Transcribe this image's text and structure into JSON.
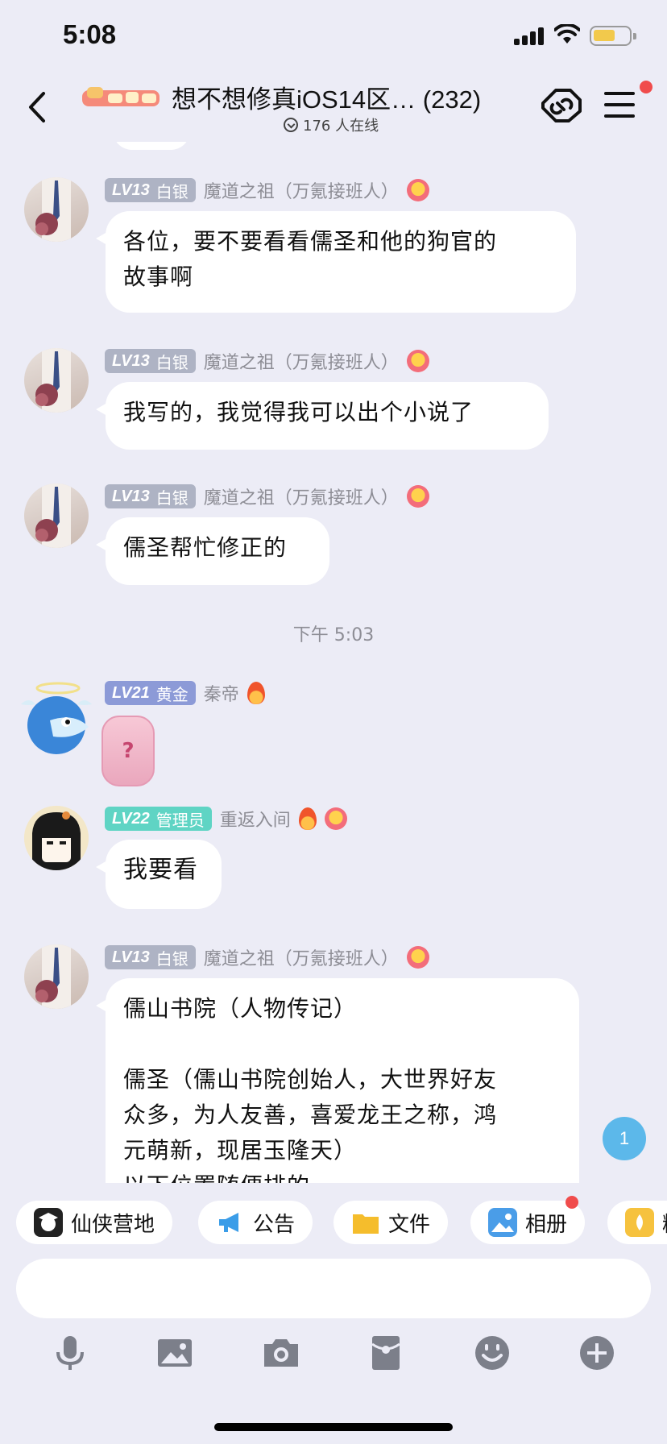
{
  "status_bar": {
    "time": "5:08"
  },
  "header": {
    "title": "想不想修真iOS14区… (232)",
    "online_count": "176 人在线"
  },
  "messages": [
    {
      "level": "LV13",
      "rank": "白银",
      "name": "魔道之祖（万氪接班人）",
      "lines": [
        "各位，要不要看看儒圣和他的狗官的",
        "故事啊"
      ]
    },
    {
      "level": "LV13",
      "rank": "白银",
      "name": "魔道之祖（万氪接班人）",
      "lines": [
        "我写的，我觉得我可以出个小说了"
      ]
    },
    {
      "level": "LV13",
      "rank": "白银",
      "name": "魔道之祖（万氪接班人）",
      "lines": [
        "儒圣帮忙修正的"
      ]
    },
    {
      "level": "LV21",
      "rank": "黄金",
      "name": "秦帝",
      "sticker": "?"
    },
    {
      "level": "LV22",
      "rank": "管理员",
      "name": "重返入间",
      "lines": [
        "我要看"
      ]
    },
    {
      "level": "LV13",
      "rank": "白银",
      "name": "魔道之祖（万氪接班人）",
      "lines": [
        "儒山书院（人物传记）",
        "",
        "儒圣（儒山书院创始人，大世界好友",
        "众多，为人友善，喜爱龙王之称，鸿",
        "元萌新，现居玉隆天）",
        "以下位置随便排的"
      ]
    }
  ],
  "time_divider": "下午 5:03",
  "unread_count": "1",
  "shortcuts": [
    "仙侠营地",
    "公告",
    "文件",
    "相册",
    "精"
  ],
  "colors": {
    "background": "#ececf6",
    "badge_silver": "#aeb3c4",
    "badge_gold": "#8c9ad7",
    "badge_admin": "#5fd4c4",
    "unread_blue": "#5cb8ea",
    "notify_red": "#f04c4c"
  },
  "icons": {
    "toolbar": [
      "microphone-icon",
      "image-icon",
      "camera-icon",
      "red-packet-icon",
      "emoji-icon",
      "plus-icon"
    ]
  }
}
